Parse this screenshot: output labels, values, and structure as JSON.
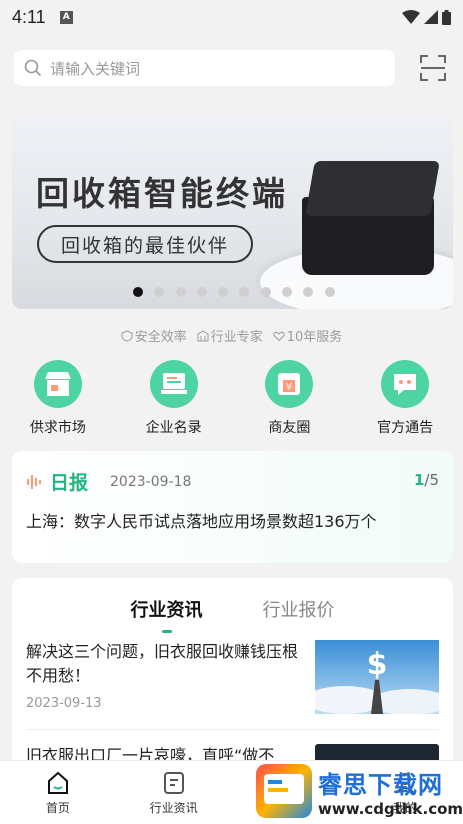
{
  "status_bar": {
    "time": "4:11",
    "notification_icon": "A"
  },
  "search": {
    "placeholder": "请输入关键词"
  },
  "banner": {
    "title": "回收箱智能终端",
    "subtitle": "回收箱的最佳伙伴",
    "dots_count": 10,
    "active_dot": 0
  },
  "features": [
    {
      "icon": "shield-icon",
      "label": "安全效率"
    },
    {
      "icon": "building-icon",
      "label": "行业专家"
    },
    {
      "icon": "heart-icon",
      "label": "10年服务"
    }
  ],
  "grid": [
    {
      "icon": "store-icon",
      "label": "供求市场"
    },
    {
      "icon": "directory-icon",
      "label": "企业名录"
    },
    {
      "icon": "yuan-icon",
      "label": "商友圈"
    },
    {
      "icon": "chat-icon",
      "label": "官方通告"
    }
  ],
  "daily": {
    "tag": "日报",
    "date": "2023-09-18",
    "page_current": "1",
    "page_total": "/5",
    "headline": "上海：数字人民币试点落地应用场景数超136万个"
  },
  "news": {
    "tabs": [
      {
        "label": "行业资讯",
        "active": true
      },
      {
        "label": "行业报价",
        "active": false
      }
    ],
    "articles": [
      {
        "title": "解决这三个问题，旧衣服回收赚钱压根不用愁！",
        "date": "2023-09-13"
      },
      {
        "title": "旧衣服出口厂一片哀嚎，直呼“做不",
        "date": ""
      }
    ]
  },
  "bottom_nav": [
    {
      "icon": "home-icon",
      "label": "首页"
    },
    {
      "icon": "news-icon",
      "label": "行业资讯"
    },
    {
      "icon": "",
      "label": ""
    },
    {
      "icon": "profile-icon",
      "label": "我的"
    }
  ],
  "watermark": {
    "title": "睿思下载网",
    "url": "www.cdgthk.com"
  },
  "colors": {
    "accent": "#22b57f",
    "icon_bg": "#4ed3a2",
    "page_bg": "#f2f2f2"
  }
}
